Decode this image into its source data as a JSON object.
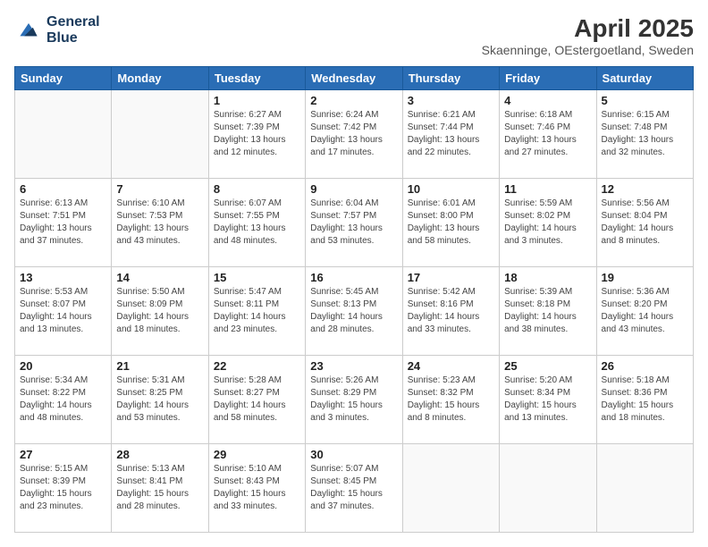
{
  "logo": {
    "line1": "General",
    "line2": "Blue"
  },
  "title": "April 2025",
  "subtitle": "Skaenninge, OEstergoetland, Sweden",
  "days_of_week": [
    "Sunday",
    "Monday",
    "Tuesday",
    "Wednesday",
    "Thursday",
    "Friday",
    "Saturday"
  ],
  "weeks": [
    [
      {
        "day": "",
        "info": ""
      },
      {
        "day": "",
        "info": ""
      },
      {
        "day": "1",
        "info": "Sunrise: 6:27 AM\nSunset: 7:39 PM\nDaylight: 13 hours and 12 minutes."
      },
      {
        "day": "2",
        "info": "Sunrise: 6:24 AM\nSunset: 7:42 PM\nDaylight: 13 hours and 17 minutes."
      },
      {
        "day": "3",
        "info": "Sunrise: 6:21 AM\nSunset: 7:44 PM\nDaylight: 13 hours and 22 minutes."
      },
      {
        "day": "4",
        "info": "Sunrise: 6:18 AM\nSunset: 7:46 PM\nDaylight: 13 hours and 27 minutes."
      },
      {
        "day": "5",
        "info": "Sunrise: 6:15 AM\nSunset: 7:48 PM\nDaylight: 13 hours and 32 minutes."
      }
    ],
    [
      {
        "day": "6",
        "info": "Sunrise: 6:13 AM\nSunset: 7:51 PM\nDaylight: 13 hours and 37 minutes."
      },
      {
        "day": "7",
        "info": "Sunrise: 6:10 AM\nSunset: 7:53 PM\nDaylight: 13 hours and 43 minutes."
      },
      {
        "day": "8",
        "info": "Sunrise: 6:07 AM\nSunset: 7:55 PM\nDaylight: 13 hours and 48 minutes."
      },
      {
        "day": "9",
        "info": "Sunrise: 6:04 AM\nSunset: 7:57 PM\nDaylight: 13 hours and 53 minutes."
      },
      {
        "day": "10",
        "info": "Sunrise: 6:01 AM\nSunset: 8:00 PM\nDaylight: 13 hours and 58 minutes."
      },
      {
        "day": "11",
        "info": "Sunrise: 5:59 AM\nSunset: 8:02 PM\nDaylight: 14 hours and 3 minutes."
      },
      {
        "day": "12",
        "info": "Sunrise: 5:56 AM\nSunset: 8:04 PM\nDaylight: 14 hours and 8 minutes."
      }
    ],
    [
      {
        "day": "13",
        "info": "Sunrise: 5:53 AM\nSunset: 8:07 PM\nDaylight: 14 hours and 13 minutes."
      },
      {
        "day": "14",
        "info": "Sunrise: 5:50 AM\nSunset: 8:09 PM\nDaylight: 14 hours and 18 minutes."
      },
      {
        "day": "15",
        "info": "Sunrise: 5:47 AM\nSunset: 8:11 PM\nDaylight: 14 hours and 23 minutes."
      },
      {
        "day": "16",
        "info": "Sunrise: 5:45 AM\nSunset: 8:13 PM\nDaylight: 14 hours and 28 minutes."
      },
      {
        "day": "17",
        "info": "Sunrise: 5:42 AM\nSunset: 8:16 PM\nDaylight: 14 hours and 33 minutes."
      },
      {
        "day": "18",
        "info": "Sunrise: 5:39 AM\nSunset: 8:18 PM\nDaylight: 14 hours and 38 minutes."
      },
      {
        "day": "19",
        "info": "Sunrise: 5:36 AM\nSunset: 8:20 PM\nDaylight: 14 hours and 43 minutes."
      }
    ],
    [
      {
        "day": "20",
        "info": "Sunrise: 5:34 AM\nSunset: 8:22 PM\nDaylight: 14 hours and 48 minutes."
      },
      {
        "day": "21",
        "info": "Sunrise: 5:31 AM\nSunset: 8:25 PM\nDaylight: 14 hours and 53 minutes."
      },
      {
        "day": "22",
        "info": "Sunrise: 5:28 AM\nSunset: 8:27 PM\nDaylight: 14 hours and 58 minutes."
      },
      {
        "day": "23",
        "info": "Sunrise: 5:26 AM\nSunset: 8:29 PM\nDaylight: 15 hours and 3 minutes."
      },
      {
        "day": "24",
        "info": "Sunrise: 5:23 AM\nSunset: 8:32 PM\nDaylight: 15 hours and 8 minutes."
      },
      {
        "day": "25",
        "info": "Sunrise: 5:20 AM\nSunset: 8:34 PM\nDaylight: 15 hours and 13 minutes."
      },
      {
        "day": "26",
        "info": "Sunrise: 5:18 AM\nSunset: 8:36 PM\nDaylight: 15 hours and 18 minutes."
      }
    ],
    [
      {
        "day": "27",
        "info": "Sunrise: 5:15 AM\nSunset: 8:39 PM\nDaylight: 15 hours and 23 minutes."
      },
      {
        "day": "28",
        "info": "Sunrise: 5:13 AM\nSunset: 8:41 PM\nDaylight: 15 hours and 28 minutes."
      },
      {
        "day": "29",
        "info": "Sunrise: 5:10 AM\nSunset: 8:43 PM\nDaylight: 15 hours and 33 minutes."
      },
      {
        "day": "30",
        "info": "Sunrise: 5:07 AM\nSunset: 8:45 PM\nDaylight: 15 hours and 37 minutes."
      },
      {
        "day": "",
        "info": ""
      },
      {
        "day": "",
        "info": ""
      },
      {
        "day": "",
        "info": ""
      }
    ]
  ]
}
